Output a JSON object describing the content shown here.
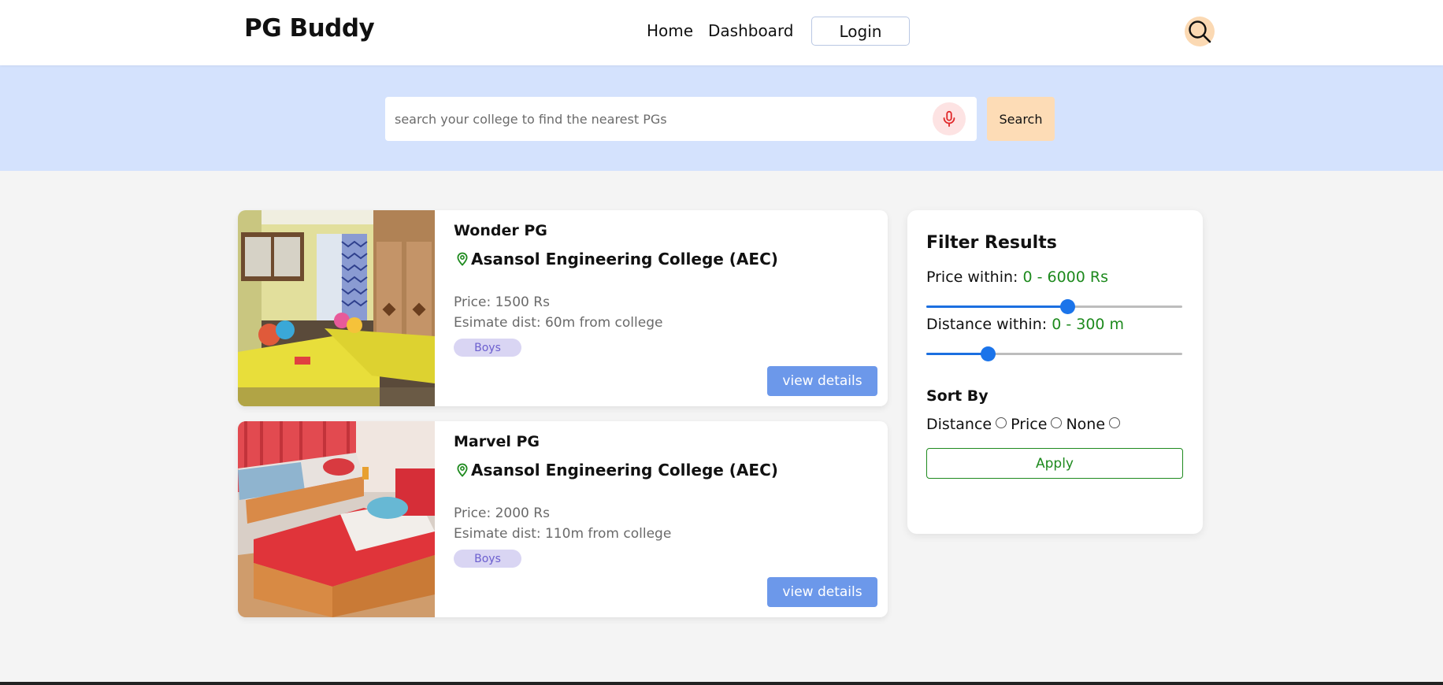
{
  "header": {
    "brand": "PG Buddy",
    "nav": {
      "home": "Home",
      "dashboard": "Dashboard",
      "login": "Login"
    },
    "search_icon": "search-icon"
  },
  "search": {
    "placeholder": "search your college to find the nearest PGs",
    "value": "",
    "mic_icon": "microphone-icon",
    "button": "Search"
  },
  "listings": [
    {
      "name": "Wonder PG",
      "location_icon": "map-pin-icon",
      "college": "Asansol Engineering College (AEC)",
      "price": "Price: 1500 Rs",
      "distance": "Esimate dist: 60m from college",
      "tag": "Boys",
      "button": "view details",
      "image": "room-photo-yellow-beds"
    },
    {
      "name": "Marvel PG",
      "location_icon": "map-pin-icon",
      "college": "Asansol Engineering College (AEC)",
      "price": "Price: 2000 Rs",
      "distance": "Esimate dist: 110m from college",
      "tag": "Boys",
      "button": "view details",
      "image": "room-photo-red-beds"
    }
  ],
  "filter": {
    "title": "Filter Results",
    "price": {
      "label": "Price within:",
      "min": "0 -",
      "max": "6000 Rs",
      "slider_fraction": 0.55
    },
    "distance": {
      "label": "Distance within:",
      "min": "0 -",
      "max": "300 m",
      "slider_fraction": 0.24
    },
    "sort": {
      "title": "Sort By",
      "options": [
        "Distance",
        "Price",
        "None"
      ]
    },
    "apply": "Apply"
  },
  "colors": {
    "accent_blue": "#6c98ea",
    "search_band": "#d4e2fd",
    "green": "#1e8a1e",
    "badge_bg": "#d9d5f3",
    "search_btn": "#fddcb6"
  }
}
